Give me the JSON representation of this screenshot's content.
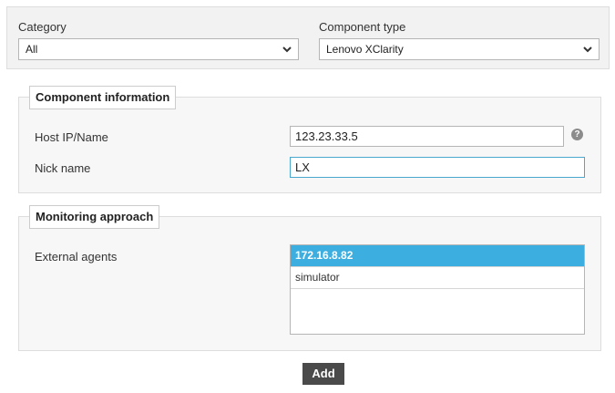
{
  "filters": {
    "category_label": "Category",
    "category_value": "All",
    "component_type_label": "Component type",
    "component_type_value": "Lenovo XClarity"
  },
  "component_information": {
    "legend": "Component information",
    "host_label": "Host IP/Name",
    "host_value": "123.23.33.5",
    "help_glyph": "?",
    "nick_label": "Nick name",
    "nick_value": "LX"
  },
  "monitoring_approach": {
    "legend": "Monitoring approach",
    "external_agents_label": "External agents",
    "agents": [
      {
        "label": "172.16.8.82",
        "selected": true
      },
      {
        "label": "simulator",
        "selected": false
      }
    ]
  },
  "actions": {
    "add_label": "Add"
  },
  "colors": {
    "accent": "#3daee0",
    "button_bg": "#4a4a4a",
    "focus_border": "#4aa8cf"
  }
}
